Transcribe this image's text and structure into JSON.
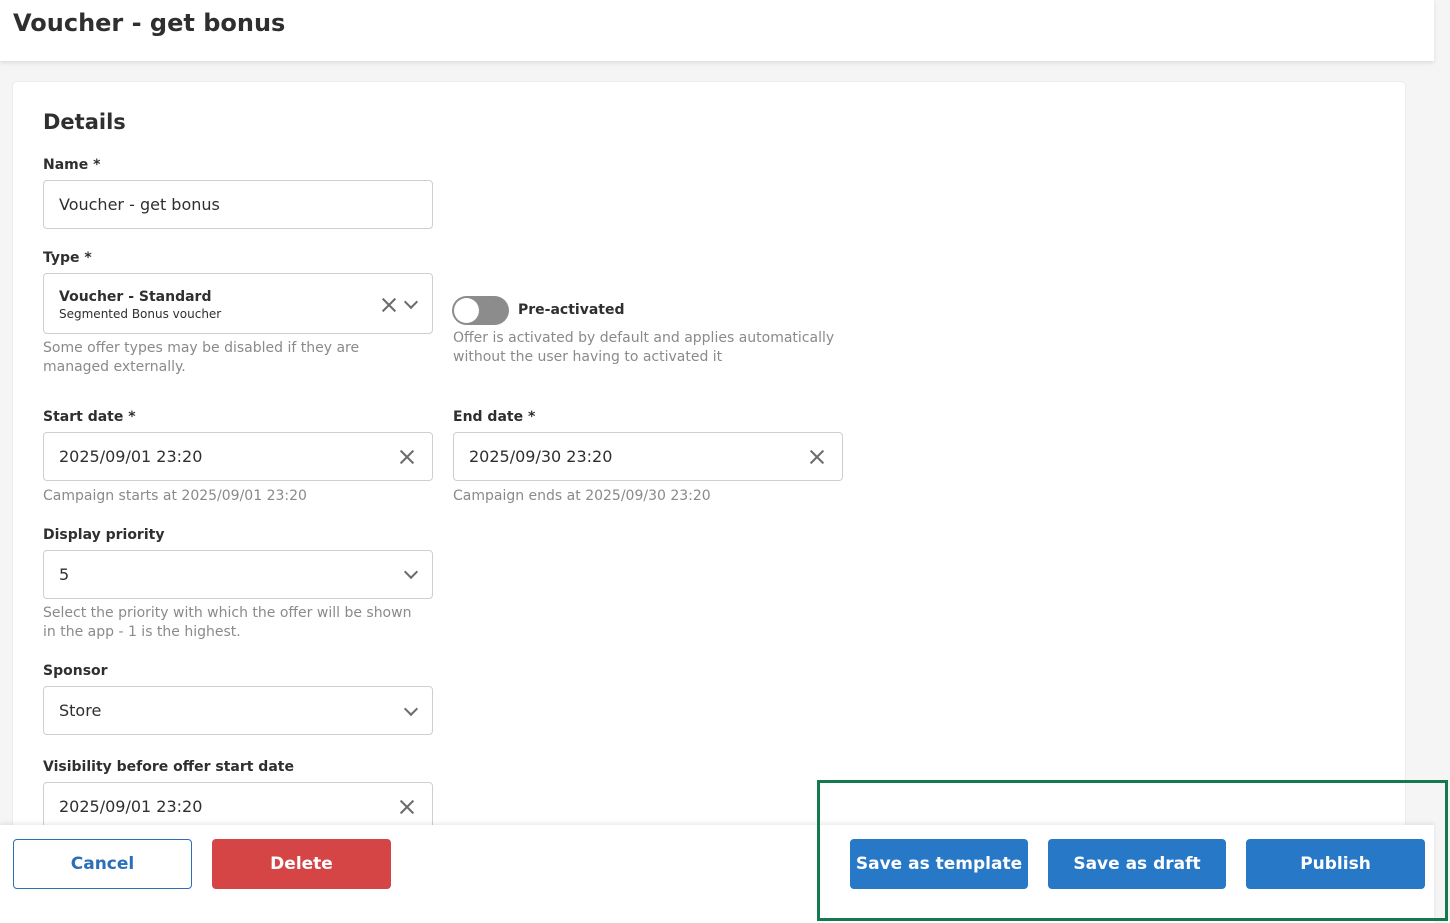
{
  "header": {
    "title": "Voucher - get bonus"
  },
  "details": {
    "section_title": "Details",
    "name": {
      "label": "Name *",
      "value": "Voucher - get bonus"
    },
    "type": {
      "label": "Type *",
      "value_title": "Voucher - Standard",
      "value_subtitle": "Segmented Bonus voucher",
      "hint": "Some offer types may be disabled if they are managed externally."
    },
    "pre_activated": {
      "label": "Pre-activated",
      "enabled": false,
      "hint": "Offer is activated by default and applies automatically without the user having to activated it"
    },
    "start_date": {
      "label": "Start date *",
      "value": "2025/09/01 23:20",
      "hint": "Campaign starts at 2025/09/01 23:20"
    },
    "end_date": {
      "label": "End date *",
      "value": "2025/09/30 23:20",
      "hint": "Campaign ends at 2025/09/30 23:20"
    },
    "display_priority": {
      "label": "Display priority",
      "value": "5",
      "hint": "Select the priority with which the offer will be shown in the app - 1 is the highest."
    },
    "sponsor": {
      "label": "Sponsor",
      "value": "Store"
    },
    "visibility": {
      "label": "Visibility before offer start date",
      "value": "2025/09/01 23:20"
    }
  },
  "footer": {
    "cancel_label": "Cancel",
    "delete_label": "Delete",
    "save_template_label": "Save as template",
    "save_draft_label": "Save as draft",
    "publish_label": "Publish"
  },
  "colors": {
    "primary": "#2878c8",
    "danger": "#d64545",
    "highlight": "#137a4f",
    "toggle_off": "#8c8c8c"
  }
}
